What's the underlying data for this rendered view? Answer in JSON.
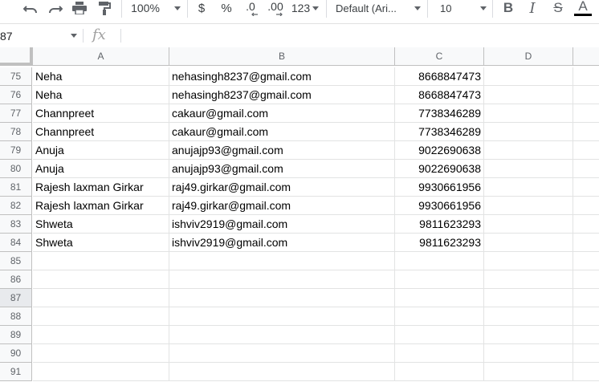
{
  "toolbar": {
    "zoom": "100%",
    "currency": "$",
    "percent": "%",
    "decrease_decimal": ".0",
    "increase_decimal": ".00",
    "more_formats": "123",
    "font_family": "Default (Ari...",
    "font_size": "10",
    "icons": [
      "undo-icon",
      "redo-icon",
      "print-icon",
      "paint-format-icon",
      "bold-icon",
      "italic-icon",
      "strikethrough-icon",
      "text-color-icon"
    ]
  },
  "formula_bar": {
    "name_box": "87",
    "fx_label": "fx",
    "content": ""
  },
  "columns": [
    "A",
    "B",
    "C",
    "D"
  ],
  "rows": [
    {
      "num": "75",
      "a": "Neha",
      "b": "nehasingh8237@gmail.com",
      "c": "8668847473"
    },
    {
      "num": "76",
      "a": "Neha",
      "b": "nehasingh8237@gmail.com",
      "c": "8668847473"
    },
    {
      "num": "77",
      "a": "Channpreet",
      "b": "cakaur@gmail.com",
      "c": "7738346289"
    },
    {
      "num": "78",
      "a": "Channpreet",
      "b": "cakaur@gmail.com",
      "c": "7738346289"
    },
    {
      "num": "79",
      "a": "Anuja",
      "b": "anujajp93@gmail.com",
      "c": "9022690638"
    },
    {
      "num": "80",
      "a": "Anuja",
      "b": "anujajp93@gmail.com",
      "c": "9022690638"
    },
    {
      "num": "81",
      "a": "Rajesh laxman Girkar",
      "b": "raj49.girkar@gmail.com",
      "c": "9930661956"
    },
    {
      "num": "82",
      "a": "Rajesh laxman Girkar",
      "b": "raj49.girkar@gmail.com",
      "c": "9930661956"
    },
    {
      "num": "83",
      "a": "Shweta",
      "b": "ishviv2919@gmail.com",
      "c": "9811623293"
    },
    {
      "num": "84",
      "a": "Shweta",
      "b": "ishviv2919@gmail.com",
      "c": "9811623293"
    },
    {
      "num": "85",
      "a": "",
      "b": "",
      "c": ""
    },
    {
      "num": "86",
      "a": "",
      "b": "",
      "c": ""
    },
    {
      "num": "87",
      "a": "",
      "b": "",
      "c": ""
    },
    {
      "num": "88",
      "a": "",
      "b": "",
      "c": ""
    },
    {
      "num": "89",
      "a": "",
      "b": "",
      "c": ""
    },
    {
      "num": "90",
      "a": "",
      "b": "",
      "c": ""
    },
    {
      "num": "91",
      "a": "",
      "b": "",
      "c": ""
    }
  ],
  "selected_row": "87",
  "colors": {
    "header_bg": "#f8f9fa",
    "selected_header_bg": "#e8eaed",
    "grid_line": "#e2e3e3",
    "text_color_bar": "#000000"
  }
}
